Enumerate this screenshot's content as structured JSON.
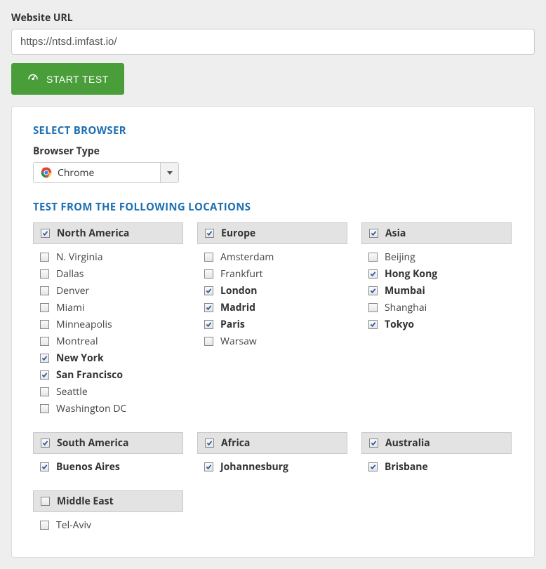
{
  "url_label": "Website URL",
  "url_value": "https://ntsd.imfast.io/",
  "start_label": "START TEST",
  "browser_section": "SELECT BROWSER",
  "browser_type_label": "Browser Type",
  "browser_selected": "Chrome",
  "locations_section": "TEST FROM THE FOLLOWING LOCATIONS",
  "regions": [
    {
      "name": "North America",
      "header_checked": true,
      "locations": [
        {
          "label": "N. Virginia",
          "checked": false
        },
        {
          "label": "Dallas",
          "checked": false
        },
        {
          "label": "Denver",
          "checked": false
        },
        {
          "label": "Miami",
          "checked": false
        },
        {
          "label": "Minneapolis",
          "checked": false
        },
        {
          "label": "Montreal",
          "checked": false
        },
        {
          "label": "New York",
          "checked": true
        },
        {
          "label": "San Francisco",
          "checked": true
        },
        {
          "label": "Seattle",
          "checked": false
        },
        {
          "label": "Washington DC",
          "checked": false
        }
      ]
    },
    {
      "name": "Europe",
      "header_checked": true,
      "locations": [
        {
          "label": "Amsterdam",
          "checked": false
        },
        {
          "label": "Frankfurt",
          "checked": false
        },
        {
          "label": "London",
          "checked": true
        },
        {
          "label": "Madrid",
          "checked": true
        },
        {
          "label": "Paris",
          "checked": true
        },
        {
          "label": "Warsaw",
          "checked": false
        }
      ]
    },
    {
      "name": "Asia",
      "header_checked": true,
      "locations": [
        {
          "label": "Beijing",
          "checked": false
        },
        {
          "label": "Hong Kong",
          "checked": true
        },
        {
          "label": "Mumbai",
          "checked": true
        },
        {
          "label": "Shanghai",
          "checked": false
        },
        {
          "label": "Tokyo",
          "checked": true
        }
      ]
    },
    {
      "name": "South America",
      "header_checked": true,
      "locations": [
        {
          "label": "Buenos Aires",
          "checked": true
        }
      ]
    },
    {
      "name": "Africa",
      "header_checked": true,
      "locations": [
        {
          "label": "Johannesburg",
          "checked": true
        }
      ]
    },
    {
      "name": "Australia",
      "header_checked": true,
      "locations": [
        {
          "label": "Brisbane",
          "checked": true
        }
      ]
    },
    {
      "name": "Middle East",
      "header_checked": false,
      "locations": [
        {
          "label": "Tel-Aviv",
          "checked": false
        }
      ]
    }
  ]
}
